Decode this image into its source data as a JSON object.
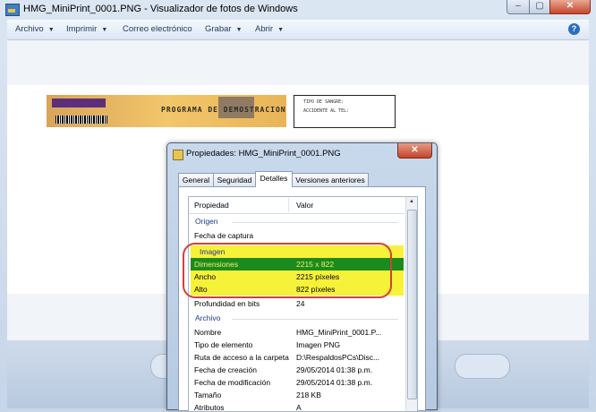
{
  "window": {
    "title": "HMG_MiniPrint_0001.PNG - Visualizador de fotos de Windows",
    "controls": {
      "minimize": "–",
      "maximize": "▢",
      "close": "✕"
    }
  },
  "menu": {
    "items": [
      {
        "label": "Archivo"
      },
      {
        "label": "Imprimir"
      },
      {
        "label": "Correo electrónico"
      },
      {
        "label": "Grabar"
      },
      {
        "label": "Abrir"
      }
    ],
    "help_icon": "?"
  },
  "photo": {
    "card_text": "PROGRAMA DE DEMOSTRACION",
    "right_text_line1": "TIPO DE SANGRE:",
    "right_text_line2": "ACCIDENTE AL TEL:"
  },
  "dialog": {
    "title": "Propiedades: HMG_MiniPrint_0001.PNG",
    "close": "✕",
    "tabs": [
      {
        "label": "General"
      },
      {
        "label": "Seguridad"
      },
      {
        "label": "Detalles"
      },
      {
        "label": "Versiones anteriores"
      }
    ],
    "active_tab": "Detalles",
    "columns": {
      "property": "Propiedad",
      "value": "Valor"
    },
    "groups": {
      "origen": "Origen",
      "imagen": "Imagen",
      "archivo": "Archivo"
    },
    "rows": {
      "fecha_captura": {
        "k": "Fecha de captura",
        "v": ""
      },
      "dimensiones": {
        "k": "Dimensiones",
        "v": "2215 x 822"
      },
      "ancho": {
        "k": "Ancho",
        "v": "2215 píxeles"
      },
      "alto": {
        "k": "Alto",
        "v": "822 píxeles"
      },
      "profundidad": {
        "k": "Profundidad en bits",
        "v": "24"
      },
      "nombre": {
        "k": "Nombre",
        "v": "HMG_MiniPrint_0001.P..."
      },
      "tipo": {
        "k": "Tipo de elemento",
        "v": "Imagen PNG"
      },
      "ruta": {
        "k": "Ruta de acceso a la carpeta",
        "v": "D:\\RespaldosPCs\\Disc..."
      },
      "creacion": {
        "k": "Fecha de creación",
        "v": "29/05/2014 01:38 p.m."
      },
      "modificacion": {
        "k": "Fecha de modificación",
        "v": "29/05/2014 01:38 p.m."
      },
      "tamano": {
        "k": "Tamaño",
        "v": "218 KB"
      },
      "atributos": {
        "k": "Atributos",
        "v": "A"
      }
    },
    "colors": {
      "highlight": "#f6f23a",
      "selected_row": "#1c8a1c",
      "oval_border": "#d0403a"
    }
  }
}
